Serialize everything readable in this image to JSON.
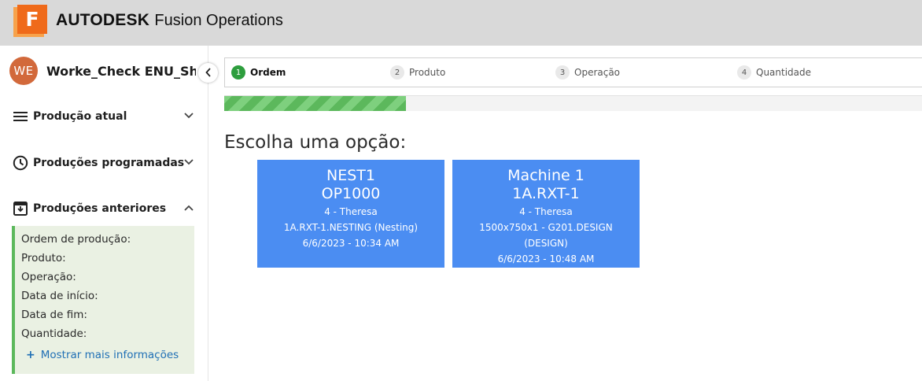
{
  "app": {
    "logo_letter": "F",
    "brand_strong": "AUTODESK",
    "brand_rest": "Fusion Operations"
  },
  "sidebar": {
    "avatar_initials": "WE",
    "user_name": "Worke_Check ENU_She...",
    "nav": [
      {
        "label": "Produção atual",
        "icon": "menu-icon",
        "expanded": false
      },
      {
        "label": "Produções programadas",
        "icon": "clock-icon",
        "expanded": false
      },
      {
        "label": "Produções anteriores",
        "icon": "archive-box-icon",
        "expanded": true
      }
    ],
    "details": {
      "order": "Ordem de produção:",
      "product": "Produto:",
      "operation": "Operação:",
      "start": "Data de início:",
      "end": "Data de fim:",
      "quantity": "Quantidade:",
      "more": "Mostrar mais informações"
    }
  },
  "stepper": {
    "steps": [
      {
        "num": "1",
        "label": "Ordem",
        "active": true
      },
      {
        "num": "2",
        "label": "Produto",
        "active": false
      },
      {
        "num": "3",
        "label": "Operação",
        "active": false
      },
      {
        "num": "4",
        "label": "Quantidade",
        "active": false
      }
    ],
    "progress_fraction": 0.26
  },
  "main": {
    "choose_title": "Escolha uma opção:",
    "options": [
      {
        "title": "NEST1",
        "subtitle": "OP1000",
        "worker": "4 - Theresa",
        "line1": "1A.RXT-1.NESTING (Nesting)",
        "line2": "",
        "datetime": "6/6/2023 - 10:34 AM"
      },
      {
        "title": "Machine 1",
        "subtitle": "1A.RXT-1",
        "worker": "4 - Theresa",
        "line1": "1500x750x1 - G201.DESIGN",
        "line2": "(DESIGN)",
        "datetime": "6/6/2023 - 10:48 AM"
      }
    ]
  },
  "colors": {
    "topbar": "#d9d9d9",
    "accent_green": "#5cb85c",
    "option_blue": "#4b8df2",
    "link_blue": "#1f6fb5",
    "logo_orange": "#ef6a1a"
  }
}
